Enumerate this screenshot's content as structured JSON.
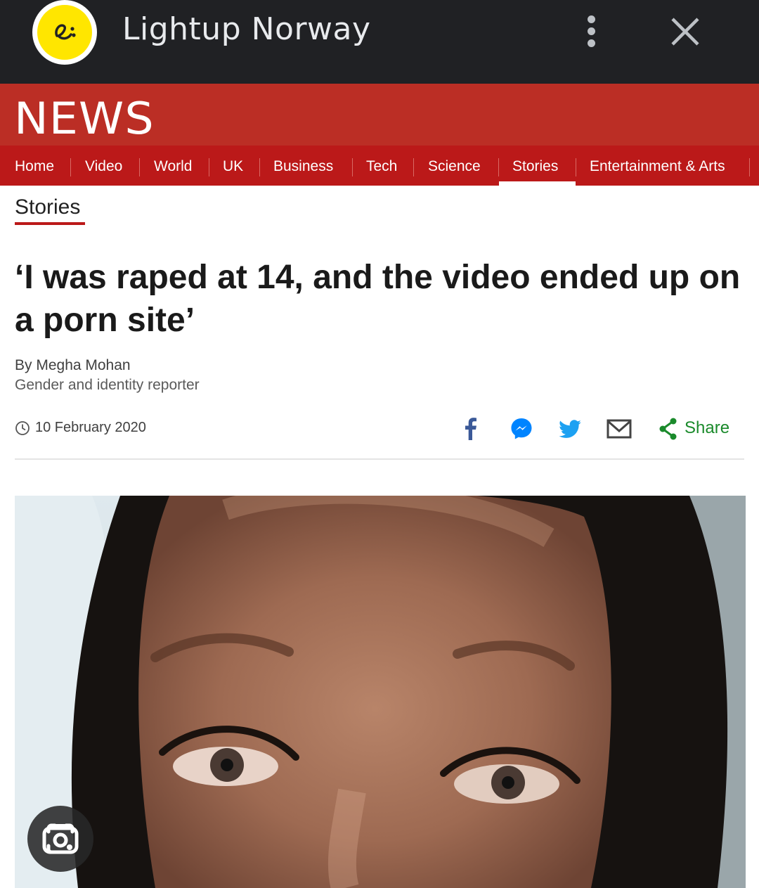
{
  "app_bar": {
    "title": "Lightup Norway",
    "logo_icon": "lightup-logo-icon",
    "menu_icon": "more-vert-icon",
    "close_icon": "close-icon"
  },
  "site": {
    "logo_text": "NEWS",
    "brand_color": "#bb1919"
  },
  "nav": {
    "items": [
      {
        "label": "Home"
      },
      {
        "label": "Video"
      },
      {
        "label": "World"
      },
      {
        "label": "UK"
      },
      {
        "label": "Business"
      },
      {
        "label": "Tech"
      },
      {
        "label": "Science"
      },
      {
        "label": "Stories",
        "active": true
      },
      {
        "label": "Entertainment & Arts"
      }
    ]
  },
  "section": {
    "label": "Stories"
  },
  "article": {
    "headline": "‘I was raped at 14, and the video ended up on a porn site’",
    "byline": "By Megha Mohan",
    "role": "Gender and identity reporter",
    "date": "10 February 2020"
  },
  "share": {
    "icons": [
      "facebook-icon",
      "messenger-icon",
      "twitter-icon",
      "email-icon"
    ],
    "label": "Share",
    "color": "#1a8a2b"
  },
  "lens_button": {
    "icon": "google-lens-icon"
  }
}
